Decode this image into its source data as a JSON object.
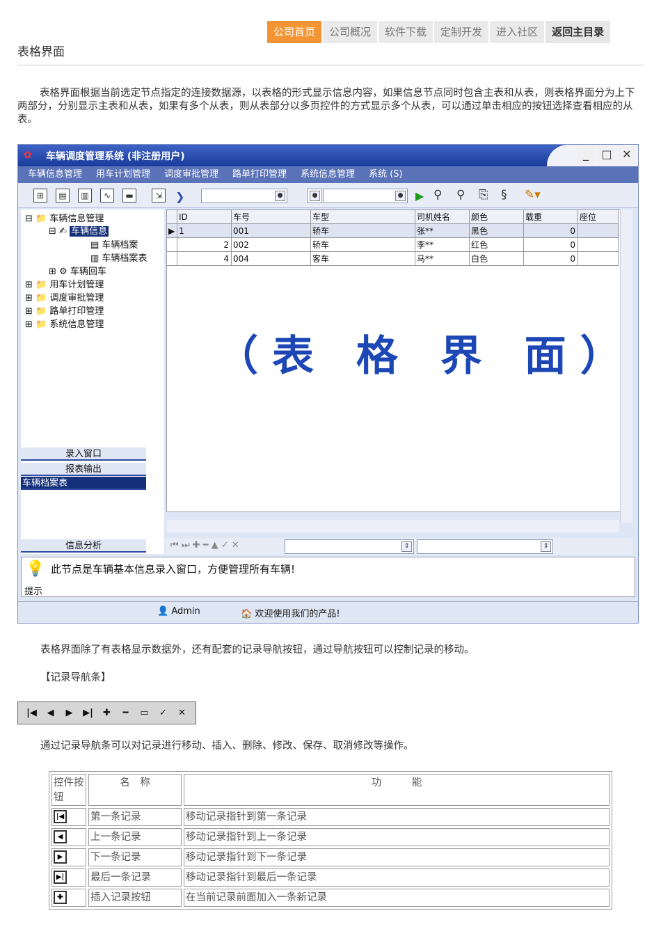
{
  "nav": [
    "公司首页",
    "公司概况",
    "软件下载",
    "定制开发",
    "进入社区",
    "返回主目录"
  ],
  "page_title": "表格界面",
  "intro_paragraph": "表格界面根据当前选定节点指定的连接数据源，以表格的形式显示信息内容，如果信息节点同时包含主表和从表，则表格界面分为上下两部分，分别显示主表和从表，如果有多个从表，则从表部分以多页控件的方式显示多个从表，可以通过单击相应的按钮选择查看相应的从表。",
  "app": {
    "title": "车辆调度管理系统 (非注册用户)",
    "menu": [
      "车辆信息管理",
      "用车计划管理",
      "调度审批管理",
      "路单打印管理",
      "系统信息管理",
      "系统 (S)"
    ],
    "tree": [
      "车辆信息管理",
      "车辆信息",
      "车辆档案",
      "车辆档案表",
      "车辆回车",
      "用车计划管理",
      "调度审批管理",
      "路单打印管理",
      "系统信息管理"
    ],
    "left_buttons": [
      "录入窗口",
      "报表输出",
      "车辆档案表",
      "信息分析"
    ],
    "grid_headers": [
      "ID",
      "车号",
      "车型",
      "司机姓名",
      "颜色",
      "载重",
      "座位"
    ],
    "grid_rows": [
      [
        "1",
        "001",
        "轿车",
        "张**",
        "黑色",
        "0"
      ],
      [
        "2",
        "002",
        "轿车",
        "李**",
        "红色",
        "0"
      ],
      [
        "4",
        "004",
        "客车",
        "马**",
        "白色",
        "0"
      ]
    ],
    "watermark": "（表 格 界 面）",
    "tip_text": "此节点是车辆基本信息录入窗口，方便管理所有车辆!",
    "tip_label": "提示",
    "status_user": "Admin",
    "status_welcome": "欢迎使用我们的产品!"
  },
  "para2": "表格界面除了有表格显示数据外，还有配套的记录导航按钮，通过导航按钮可以控制记录的移动。",
  "section_label": "【记录导航条】",
  "para3": "通过记录导航条可以对记录进行移动、插入、删除、修改、保存、取消修改等操作。",
  "table": {
    "headers": [
      "控件按钮",
      "名　称",
      "功　　　能"
    ],
    "rows": [
      {
        "icon": "|◀",
        "name": "第一条记录",
        "func": "移动记录指针到第一条记录"
      },
      {
        "icon": "◀",
        "name": "上一条记录",
        "func": "移动记录指针到上一条记录"
      },
      {
        "icon": "▶",
        "name": "下一条记录",
        "func": "移动记录指针到下一条记录"
      },
      {
        "icon": "▶|",
        "name": "最后一条记录",
        "func": "移动记录指针到最后一条记录"
      },
      {
        "icon": "✚",
        "name": "插入记录按钮",
        "func": "在当前记录前面加入一条新记录"
      }
    ]
  }
}
